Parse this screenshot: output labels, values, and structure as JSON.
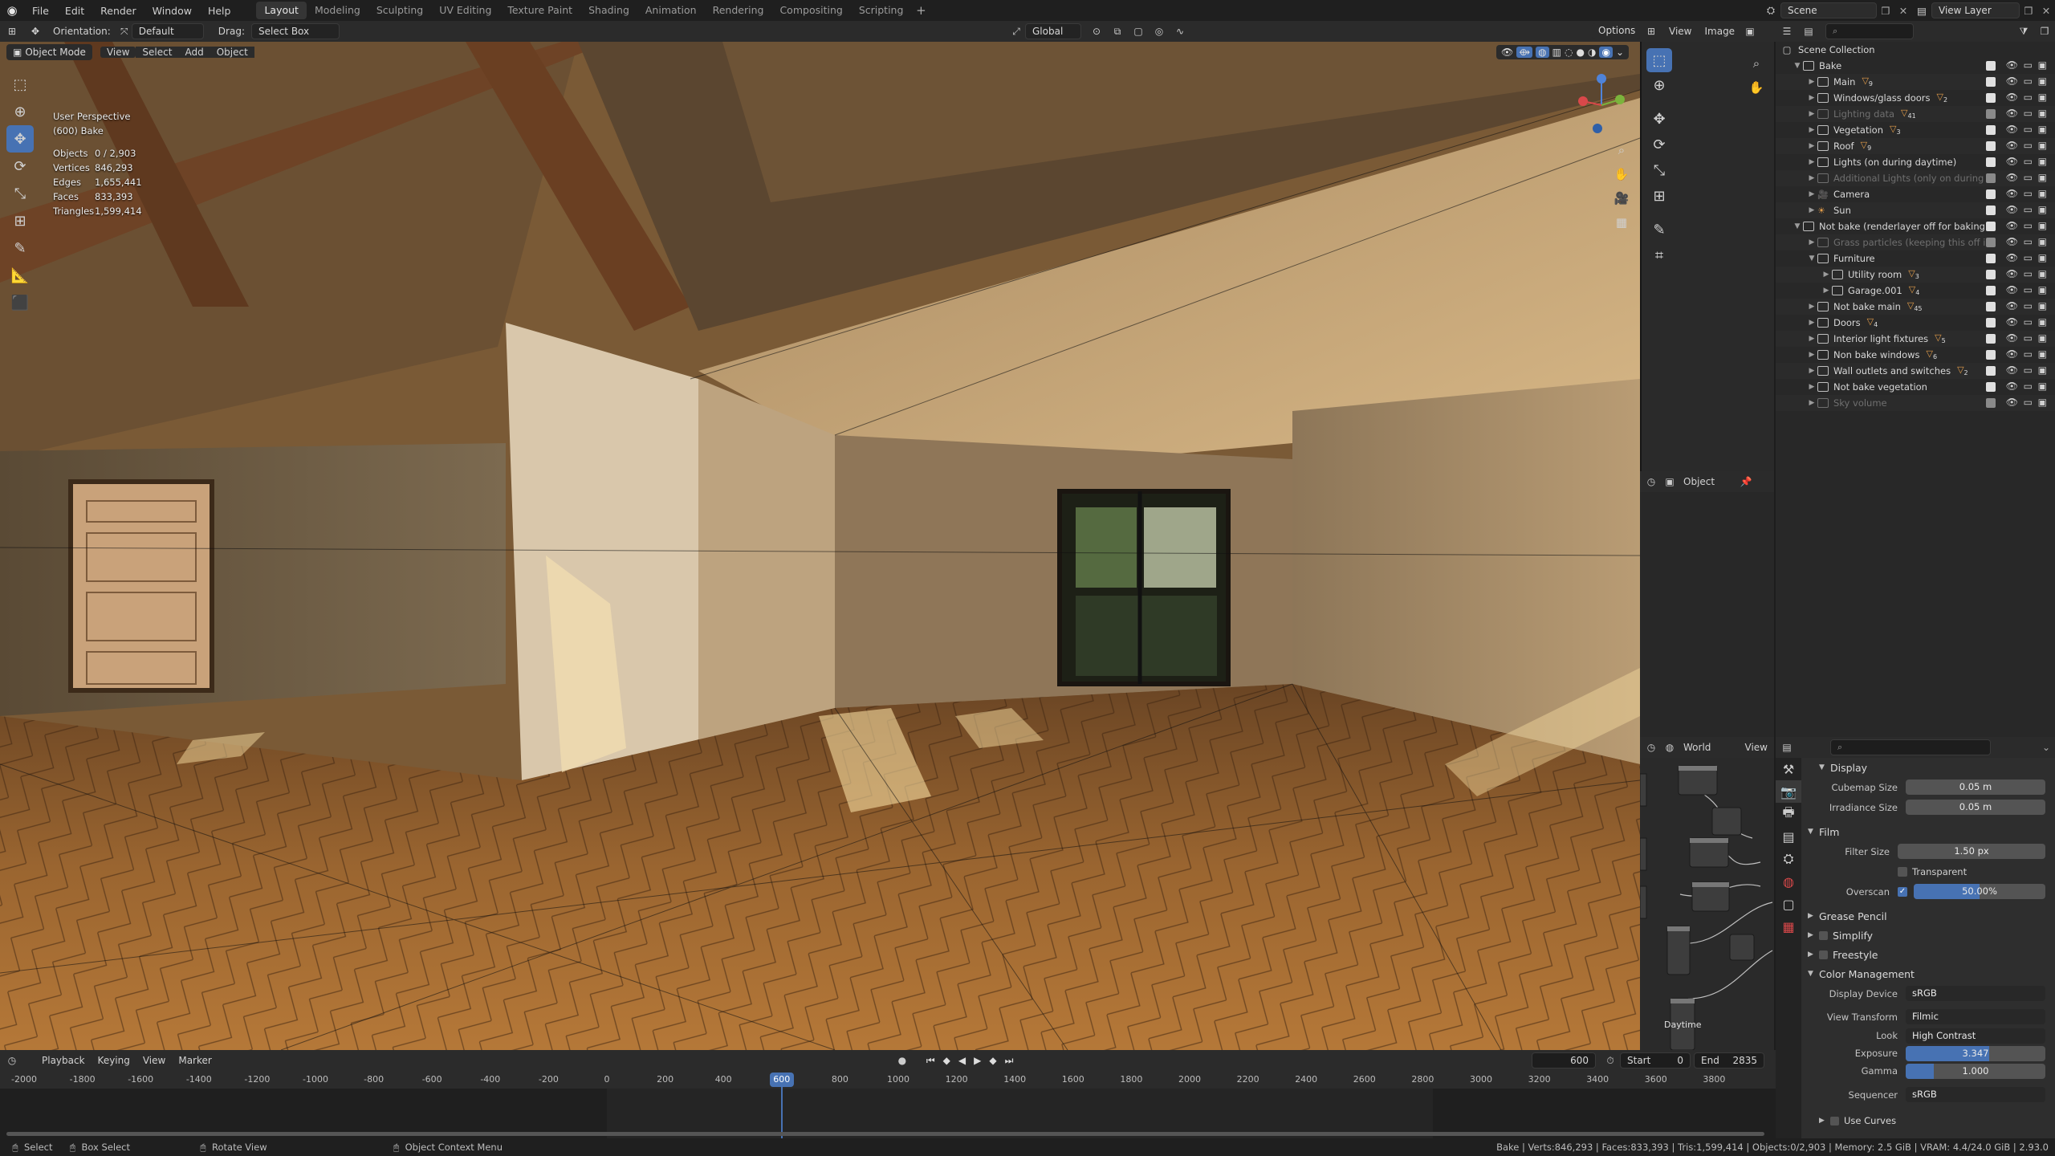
{
  "menu": {
    "items": [
      "File",
      "Edit",
      "Render",
      "Window",
      "Help"
    ]
  },
  "workspaces": {
    "tabs": [
      "Layout",
      "Modeling",
      "Sculpting",
      "UV Editing",
      "Texture Paint",
      "Shading",
      "Animation",
      "Rendering",
      "Compositing",
      "Scripting"
    ],
    "active": "Layout"
  },
  "scene": {
    "name": "Scene",
    "view_layer": "View Layer"
  },
  "toolheader": {
    "orientation_label": "Orientation:",
    "orientation_value": "Default",
    "drag_label": "Drag:",
    "drag_value": "Select Box",
    "transform_space": "Global",
    "options": "Options"
  },
  "viewport_header": {
    "mode": "Object Mode",
    "view": "View",
    "select": "Select",
    "add": "Add",
    "object": "Object"
  },
  "overlay": {
    "perspective": "User Perspective",
    "collection": "(600) Bake"
  },
  "stats": [
    {
      "label": "Objects",
      "value": "0 / 2,903"
    },
    {
      "label": "Vertices",
      "value": "846,293"
    },
    {
      "label": "Edges",
      "value": "1,655,441"
    },
    {
      "label": "Faces",
      "value": "833,393"
    },
    {
      "label": "Triangles",
      "value": "1,599,414"
    }
  ],
  "image_editor": {
    "view": "View",
    "image": "Image"
  },
  "node_editor": {
    "object_label": "Object",
    "world_label": "World",
    "view_label": "View",
    "daytime_label": "Daytime"
  },
  "outliner": {
    "root": "Scene Collection",
    "rows": [
      {
        "label": "Bake",
        "depth": 0,
        "expanded": true,
        "dim": false
      },
      {
        "label": "Main",
        "depth": 1,
        "expanded": false,
        "dim": false,
        "badge": "9"
      },
      {
        "label": "Windows/glass doors",
        "depth": 1,
        "expanded": false,
        "dim": false,
        "badge": "2"
      },
      {
        "label": "Lighting data",
        "depth": 1,
        "expanded": false,
        "dim": true,
        "badge": "41"
      },
      {
        "label": "Vegetation",
        "depth": 1,
        "expanded": false,
        "dim": false,
        "badge": "3"
      },
      {
        "label": "Roof",
        "depth": 1,
        "expanded": false,
        "dim": false,
        "badge": "9"
      },
      {
        "label": "Lights (on during daytime)",
        "depth": 1,
        "expanded": false,
        "dim": false,
        "badge": ""
      },
      {
        "label": "Additional Lights (only on during ni",
        "depth": 1,
        "expanded": false,
        "dim": true,
        "badge": ""
      },
      {
        "label": "Camera",
        "depth": 1,
        "expanded": false,
        "dim": false,
        "badge": ""
      },
      {
        "label": "Sun",
        "depth": 1,
        "expanded": false,
        "dim": false,
        "badge": ""
      },
      {
        "label": "Not bake (renderlayer off for baking)",
        "depth": 0,
        "expanded": true,
        "dim": false
      },
      {
        "label": "Grass particles (keeping this off in",
        "depth": 1,
        "expanded": false,
        "dim": true,
        "badge": ""
      },
      {
        "label": "Furniture",
        "depth": 1,
        "expanded": true,
        "dim": false,
        "badge": ""
      },
      {
        "label": "Utility room",
        "depth": 2,
        "expanded": false,
        "dim": false,
        "badge": "3"
      },
      {
        "label": "Garage.001",
        "depth": 2,
        "expanded": false,
        "dim": false,
        "badge": "4"
      },
      {
        "label": "Not bake main",
        "depth": 1,
        "expanded": false,
        "dim": false,
        "badge": "45"
      },
      {
        "label": "Doors",
        "depth": 1,
        "expanded": false,
        "dim": false,
        "badge": "4"
      },
      {
        "label": "Interior light fixtures",
        "depth": 1,
        "expanded": false,
        "dim": false,
        "badge": "5"
      },
      {
        "label": "Non bake windows",
        "depth": 1,
        "expanded": false,
        "dim": false,
        "badge": "6"
      },
      {
        "label": "Wall outlets and switches",
        "depth": 1,
        "expanded": false,
        "dim": false,
        "badge": "2"
      },
      {
        "label": "Not bake vegetation",
        "depth": 1,
        "expanded": false,
        "dim": false,
        "badge": ""
      },
      {
        "label": "Sky volume",
        "depth": 1,
        "expanded": false,
        "dim": true,
        "badge": ""
      }
    ]
  },
  "properties": {
    "display": {
      "title": "Display",
      "cubemap_label": "Cubemap Size",
      "cubemap_value": "0.05 m",
      "irradiance_label": "Irradiance Size",
      "irradiance_value": "0.05 m"
    },
    "film": {
      "title": "Film",
      "filter_label": "Filter Size",
      "filter_value": "1.50 px",
      "transparent_label": "Transparent",
      "overscan_label": "Overscan",
      "overscan_value": "50.00%",
      "overscan_fraction": 0.5
    },
    "grease_pencil": "Grease Pencil",
    "simplify": "Simplify",
    "freestyle": "Freestyle",
    "color_management": {
      "title": "Color Management",
      "display_device_label": "Display Device",
      "display_device": "sRGB",
      "view_transform_label": "View Transform",
      "view_transform": "Filmic",
      "look_label": "Look",
      "look": "High Contrast",
      "exposure_label": "Exposure",
      "exposure": "3.347",
      "exposure_fraction": 0.6,
      "gamma_label": "Gamma",
      "gamma": "1.000",
      "gamma_fraction": 0.2,
      "sequencer_label": "Sequencer",
      "sequencer": "sRGB",
      "use_curves": "Use Curves"
    }
  },
  "timeline": {
    "playback": "Playback",
    "keying": "Keying",
    "view": "View",
    "marker": "Marker",
    "current_frame": "600",
    "start_label": "Start",
    "start": "0",
    "end_label": "End",
    "end": "2835",
    "ruler": [
      "-2000",
      "-1800",
      "-1600",
      "-1400",
      "-1200",
      "-1000",
      "-800",
      "-600",
      "-400",
      "-200",
      "0",
      "200",
      "400",
      "600",
      "800",
      "1000",
      "1200",
      "1400",
      "1600",
      "1800",
      "2000",
      "2200",
      "2400",
      "2600",
      "2800",
      "3000",
      "3200",
      "3400",
      "3600",
      "3800"
    ],
    "range_start": 0,
    "range_end": 2835
  },
  "statusbar": {
    "select": "Select",
    "box_select": "Box Select",
    "rotate_view": "Rotate View",
    "context_menu": "Object Context Menu",
    "info": "Bake | Verts:846,293 | Faces:833,393 | Tris:1,599,414 | Objects:0/2,903 | Memory: 2.5 GiB | VRAM: 4.4/24.0 GiB | 2.93.0"
  },
  "colors": {
    "accent": "#4772b3",
    "bg": "#1d1d1d",
    "panel": "#2e2e2e",
    "collection_icon": "#d8d8d8",
    "mesh_badge": "#e59e4a",
    "light_icon": "#e59e4a",
    "camera_icon": "#4caf7b"
  }
}
